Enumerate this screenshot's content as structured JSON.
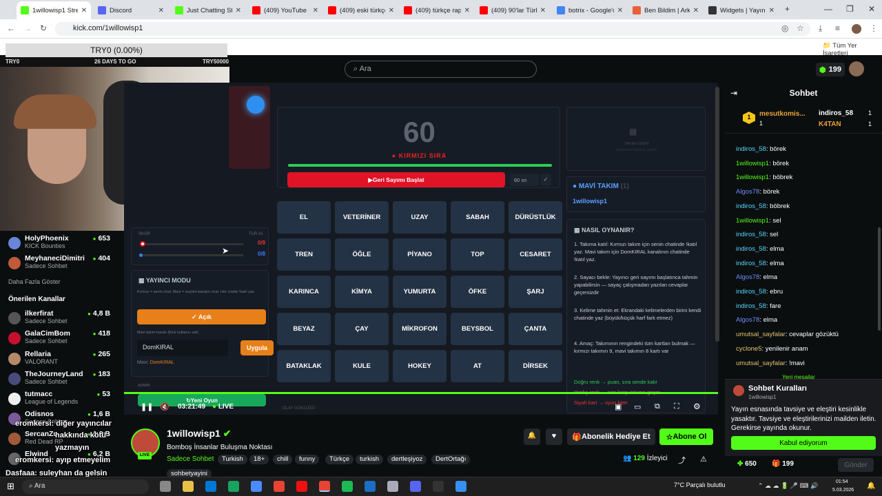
{
  "browser": {
    "tabs": [
      {
        "title": "1willowisp1 Strea",
        "color": "#53fc18",
        "active": true
      },
      {
        "title": "Discord",
        "color": "#5865f2"
      },
      {
        "title": "Just Chatting Strea",
        "color": "#53fc18"
      },
      {
        "title": "(409) YouTube",
        "color": "#ff0000"
      },
      {
        "title": "(409) eski türkçe ra",
        "color": "#ff0000"
      },
      {
        "title": "(409) türkçe rap il",
        "color": "#ff0000"
      },
      {
        "title": "(409) 90'lar Türkç",
        "color": "#ff0000"
      },
      {
        "title": "botrix - Google'da",
        "color": "#4285f4"
      },
      {
        "title": "Ben Bildim | Arkad",
        "color": "#e8603c"
      },
      {
        "title": "Widgets | Yayınını",
        "color": "#333333"
      }
    ],
    "url": "kick.com/1willowisp1",
    "bookmarks_label": "Tüm Yer İşaretleri"
  },
  "header": {
    "search_placeholder": "Ara",
    "coins": "199"
  },
  "overlay": {
    "goal_text": "TRY0 (0.00%)",
    "goal_left": "TRY0",
    "days_to_go": "26 DAYS TO GO",
    "goal_right": "TRY50000"
  },
  "sidebar": {
    "followed": [
      {
        "name": "HolyPhoenix",
        "sub": "KICK Bounties",
        "viewers": "653",
        "color": "#6a86d8"
      },
      {
        "name": "MeyhaneciDimitri",
        "sub": "Sadece Sohbet",
        "viewers": "404",
        "color": "#c05a3a"
      }
    ],
    "show_more": "Daha Fazla Göster",
    "recommended_title": "Önerilen Kanallar",
    "recommended": [
      {
        "name": "ilkerfirat",
        "sub": "Sadece Sohbet",
        "viewers": "4,8 B",
        "color": "#555"
      },
      {
        "name": "GalaCimBom",
        "sub": "Sadece Sohbet",
        "viewers": "418",
        "color": "#c8102e"
      },
      {
        "name": "Rellaria",
        "sub": "VALORANT",
        "viewers": "265",
        "color": "#b48a6a"
      },
      {
        "name": "TheJourneyLand",
        "sub": "Sadece Sohbet",
        "viewers": "183",
        "color": "#4b4b7a"
      },
      {
        "name": "tutmacc",
        "sub": "League of Legends",
        "viewers": "53",
        "color": "#eee"
      },
      {
        "name": "Odisnos",
        "sub": "Sadece Sohbet",
        "viewers": "1,6 B",
        "color": "#7a5a9a"
      },
      {
        "name": "SercanZu",
        "sub": "Red Dead RP",
        "viewers": "1,2 B",
        "color": "#a05a3a"
      },
      {
        "name": "Elwind",
        "sub": "",
        "viewers": "6,2 B",
        "color": "#666"
      }
    ],
    "ticker": [
      "eromkersi: diğer yayıncılar",
      "hakkında kötü",
      "yazmayın",
      "eromkersi: ayıp etmeyelim",
      "Dasfaaa: suleyhan da gelsin"
    ]
  },
  "game": {
    "timer": "60",
    "turn_label": "KIRMIZI SIRA",
    "start_button": "Geri Sayımı Başlat",
    "seconds_value": "60",
    "seconds_unit": "sn",
    "score_label": "SKOR",
    "round_label": "TUR #1",
    "red_score": "0/9",
    "blue_score": "0/8",
    "mode_title": "YAYINCI MODU",
    "mode_desc": "Kırmızı = senin chat, Mavi = seçilen kanalın chat. Her chatte !katıl yaz.",
    "open_button": "✓ Açık",
    "channel_hint": "Mavi takım kanalı (Kick kullanıcı adı)",
    "channel_value": "DomKIRAL",
    "apply_button": "Uygula",
    "blue_channel_label": "Mavi:",
    "blue_channel_name": "DomKIRAL",
    "admin_label": "ADMİN",
    "new_game_button": "Yeni Oyun",
    "log_label": "OLAY GÜNLÜĞÜ",
    "words": [
      "EL",
      "VETERİNER",
      "UZAY",
      "SABAH",
      "DÜRÜSTLÜK",
      "TREN",
      "ÖĞLE",
      "PİYANO",
      "TOP",
      "CESARET",
      "KARINCA",
      "KİMYA",
      "YUMURTA",
      "ÖFKE",
      "ŞARJ",
      "BEYAZ",
      "ÇAY",
      "MİKROFON",
      "BEYSBOL",
      "ÇANTA",
      "BATAKLAK",
      "KULE",
      "HOKEY",
      "AT",
      "DİRSEK"
    ],
    "team_leader_title": "TAKIM LİDERİ",
    "team_leader_sub": "Kelimeleri bilmesi yeterli",
    "blue_team_title": "MAVİ TAKIM",
    "blue_team_count": "(1)",
    "blue_team_member": "1willowisp1",
    "howto_title": "NASIL OYNANIR?",
    "howto": [
      "1. Takıma katıl: Kırmızı takım için senin chatinde !katıl yaz. Mavi takım için DomKIRAL kanalının chatinde !katıl yaz.",
      "2. Sayacı bekle: Yayıncı geri sayımı başlatınca tahmin yapabilirsin — sayaç çalışmadan yazılan cevaplar geçersizdir",
      "3. Kelime tahmin et: Ekrandaki kelimelerden birini kendi chatinde yaz (büyük/küçük harf fark etmez)",
      "4. Amaç: Takımının rengindeki tüm kartları bulmak — kırmızı takımın 9, mavi takımın 8 kartı var",
      "Doğru renk → puan, sıra sende kalır",
      "Yanlış renk → sıra karşı takıma geçer",
      "Siyah kart → oyun biter"
    ]
  },
  "player": {
    "time": "03:21:49",
    "live": "LIVE"
  },
  "channel": {
    "name": "1willowisp1",
    "live_badge": "LIVE",
    "title": "Bomboş İnsanlar Buluşma Noktası",
    "category": "Sadece Sohbet",
    "tags": [
      "Turkish",
      "18+",
      "chill",
      "funny",
      "Türkçe",
      "turkish",
      "dertleşiyoz",
      "DertOrtağı",
      "sohbetyayini"
    ],
    "gift_button": "Abonelik Hediye Et",
    "follow_button": "Abone Ol",
    "viewers": "129",
    "viewers_label": "İzleyici"
  },
  "chat": {
    "title": "Sohbet",
    "pinned": [
      {
        "name": "mesutkomis...",
        "count": "1"
      },
      {
        "name": "indiros_58",
        "count": "1"
      },
      {
        "name": "K4TAN",
        "count": "1"
      }
    ],
    "messages": [
      {
        "user": "indiros_58",
        "text": ": börek",
        "color": "#55d5ff"
      },
      {
        "user": "1willowisp1",
        "text": ": börek",
        "color": "#53fc18"
      },
      {
        "user": "1willowisp1",
        "text": ": böbrek",
        "color": "#53fc18"
      },
      {
        "user": "Algos78",
        "text": ": börek",
        "color": "#6f8cff"
      },
      {
        "user": "indiros_58",
        "text": ": böbrek",
        "color": "#55d5ff"
      },
      {
        "user": "1willowisp1",
        "text": ": sel",
        "color": "#53fc18"
      },
      {
        "user": "indiros_58",
        "text": ": sel",
        "color": "#55d5ff"
      },
      {
        "user": "indiros_58",
        "text": ": elma",
        "color": "#55d5ff"
      },
      {
        "user": "indiros_58",
        "text": ": elma",
        "color": "#55d5ff"
      },
      {
        "user": "Algos78",
        "text": ": elma",
        "color": "#6f8cff"
      },
      {
        "user": "indiros_58",
        "text": ": ebru",
        "color": "#55d5ff"
      },
      {
        "user": "indiros_58",
        "text": ": fare",
        "color": "#55d5ff"
      },
      {
        "user": "Algos78",
        "text": ": elma",
        "color": "#6f8cff"
      },
      {
        "user": "umutsal_sayfalar",
        "text": ": cevaplar gözüktü",
        "color": "#e0c070"
      },
      {
        "user": "cyclone5",
        "text": ": yenilenir anam",
        "color": "#e0c070"
      },
      {
        "user": "umutsal_sayfalar",
        "text": ": !mavi",
        "color": "#e0c070"
      }
    ],
    "new_messages": "Yeni mesajlar",
    "rules_title": "Sohbet Kuralları",
    "rules_user": "1willowisp1",
    "rules_text": "Yayın esnasında tavsiye ve eleştiri kesinlikle yasaktır. Tavsiye ve eleştirilerinizi mailden iletin. Gerekirse yayında okunur.",
    "accept_button": "Kabul ediyorum",
    "points": "650",
    "gifts": "199",
    "send_button": "Gönder"
  },
  "taskbar": {
    "search": "Ara",
    "weather": "7°C  Parçalı bulutlu",
    "time": "01:54",
    "date": "5.03.2026"
  }
}
